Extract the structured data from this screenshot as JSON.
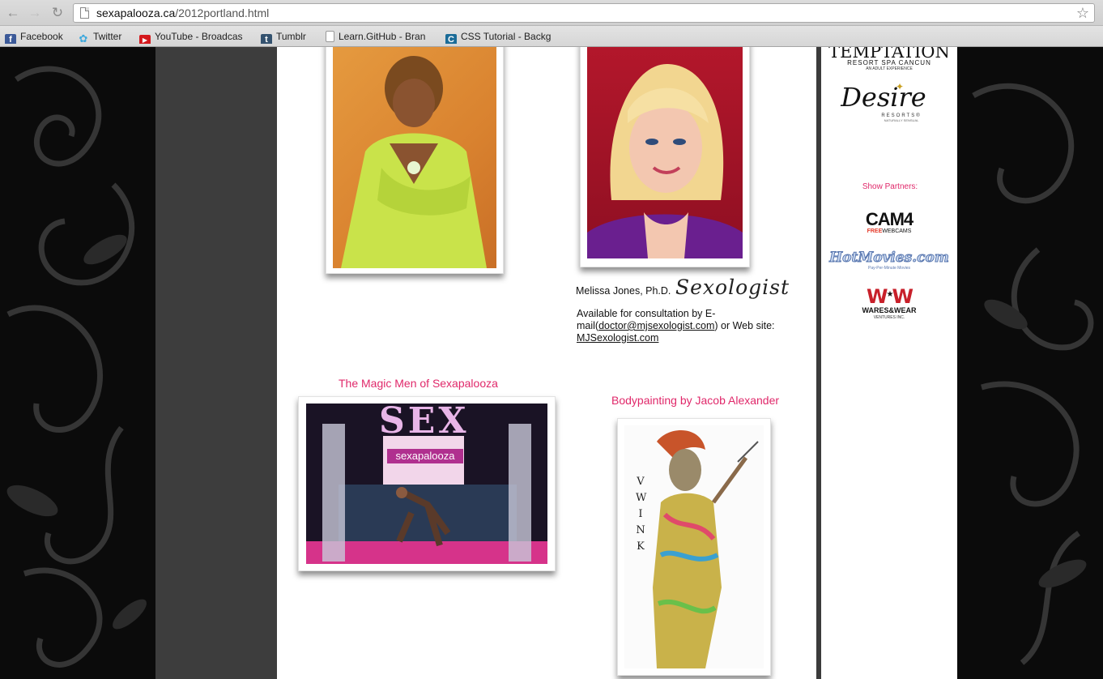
{
  "browser": {
    "url_host": "sexapalooza.ca",
    "url_path": "/2012portland.html",
    "bookmarks": [
      {
        "label": "Facebook",
        "icon": "facebook-icon"
      },
      {
        "label": "Twitter",
        "icon": "twitter-icon"
      },
      {
        "label": "YouTube - Broadcas",
        "icon": "youtube-icon"
      },
      {
        "label": "Tumblr",
        "icon": "tumblr-icon"
      },
      {
        "label": "Learn.GitHub - Bran",
        "icon": "page-icon"
      },
      {
        "label": "CSS Tutorial - Backg",
        "icon": "css-icon"
      }
    ]
  },
  "main": {
    "melissa": {
      "name": "Melissa Jones, Ph.D.",
      "logo_text": "Sexologist",
      "bio_prefix": "Available for consultation by E-mail(",
      "email": "doctor@mjsexologist.com",
      "bio_middle": ") or Web site: ",
      "website": "MJSexologist.com"
    },
    "magic_men": {
      "title": "The Magic Men of Sexapalooza",
      "sign_text": "SEX",
      "banner_text": "sexapalooza"
    },
    "bodypainting": {
      "title": "Bodypainting by Jacob Alexander",
      "side_text": "VWINK"
    }
  },
  "sidebar": {
    "temptation": {
      "name": "TEMPTATION",
      "sub": "RESORT SPA  CANCUN",
      "tag": "AN ADULT EXPERIENCE"
    },
    "desire": {
      "name": "Desire",
      "sub": "RESORTS®",
      "tag": "NATURALLY SENSUAL"
    },
    "partners_label": "Show Partners:",
    "cam4": {
      "name": "CAM4",
      "sub1": "FREE",
      "sub2": "WEBCAMS"
    },
    "hotmovies": {
      "name": "HotMovies.com",
      "tag": "Pay-Per-Minute Movies"
    },
    "wares": {
      "name": "WARES&WEAR",
      "sub": "VENTURES INC."
    }
  },
  "colors": {
    "accent_pink": "#e0286a",
    "page_bg": "#0a0a0a",
    "column_gray": "#3d3d3d"
  }
}
